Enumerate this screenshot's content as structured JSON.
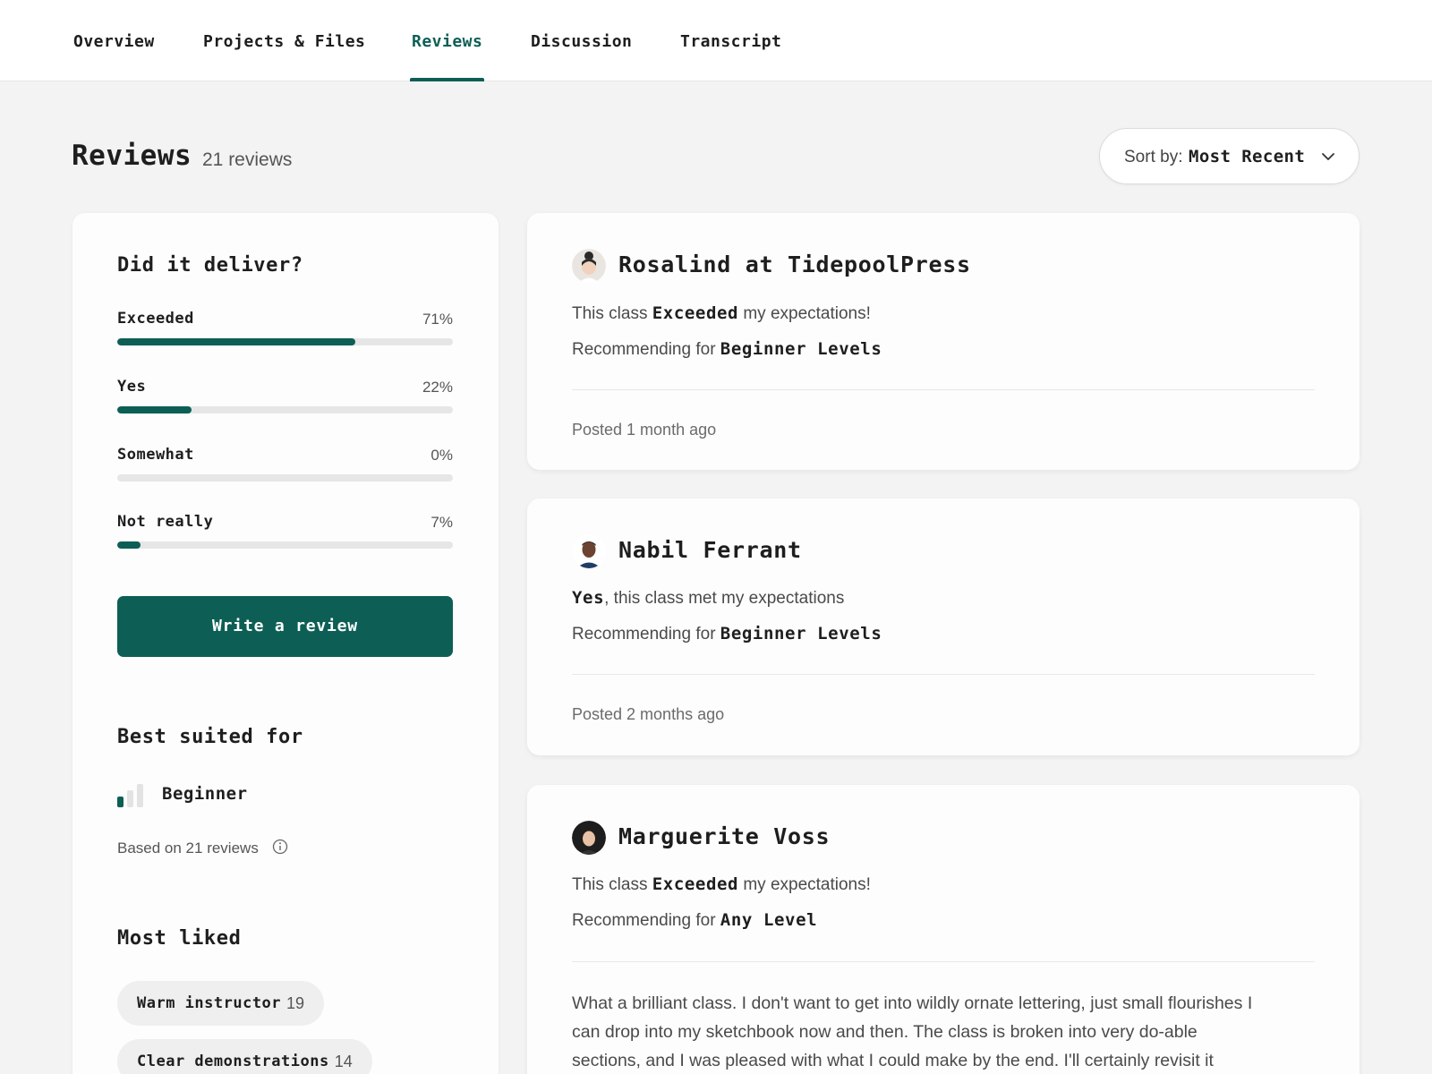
{
  "nav": {
    "tabs": [
      {
        "label": "Overview"
      },
      {
        "label": "Projects & Files"
      },
      {
        "label": "Reviews"
      },
      {
        "label": "Discussion"
      },
      {
        "label": "Transcript"
      }
    ],
    "active_tab": "Reviews"
  },
  "header": {
    "title": "Reviews",
    "count": "21 reviews",
    "sort_label": "Sort by:",
    "sort_value": "Most Recent"
  },
  "summary": {
    "deliver_title": "Did it deliver?",
    "ratings": [
      {
        "label": "Exceeded",
        "pct_text": "71%",
        "value": 71
      },
      {
        "label": "Yes",
        "pct_text": "22%",
        "value": 22
      },
      {
        "label": "Somewhat",
        "pct_text": "0%",
        "value": 0
      },
      {
        "label": "Not really",
        "pct_text": "7%",
        "value": 7
      }
    ],
    "write_review": "Write a review",
    "best_suited_title": "Best suited for",
    "level": "Beginner",
    "based_on": "Based on 21 reviews",
    "most_liked_title": "Most liked",
    "liked": [
      {
        "label": "Warm instructor",
        "count": "19"
      },
      {
        "label": "Clear demonstrations",
        "count": "14"
      }
    ]
  },
  "reviews": [
    {
      "name": "Rosalind at TidepoolPress",
      "line1_pre": "This class ",
      "line1_bold": "Exceeded",
      "line1_post": " my expectations!",
      "rec_pre": "Recommending for ",
      "rec_bold": "Beginner Levels",
      "posted": "Posted 1 month ago"
    },
    {
      "name": "Nabil Ferrant",
      "line1_pre": "",
      "line1_bold": "Yes",
      "line1_post": ", this class met my expectations",
      "rec_pre": "Recommending for ",
      "rec_bold": "Beginner Levels",
      "posted": "Posted 2 months ago"
    },
    {
      "name": "Marguerite Voss",
      "line1_pre": "This class ",
      "line1_bold": "Exceeded",
      "line1_post": " my expectations!",
      "rec_pre": "Recommending for ",
      "rec_bold": "Any Level",
      "body": "What a brilliant class. I don't want to get into wildly ornate lettering, just small flourishes I can drop into my sketchbook now and then. The class is broken into very do-able sections, and I was pleased with what I could make by the end. I'll certainly revisit it"
    }
  ],
  "colors": {
    "accent": "#0d5f55",
    "background": "#f3f3f3",
    "card": "#fdfdfd"
  },
  "icons": [
    "chevron-down-icon",
    "info-icon",
    "level-bars-icon"
  ]
}
